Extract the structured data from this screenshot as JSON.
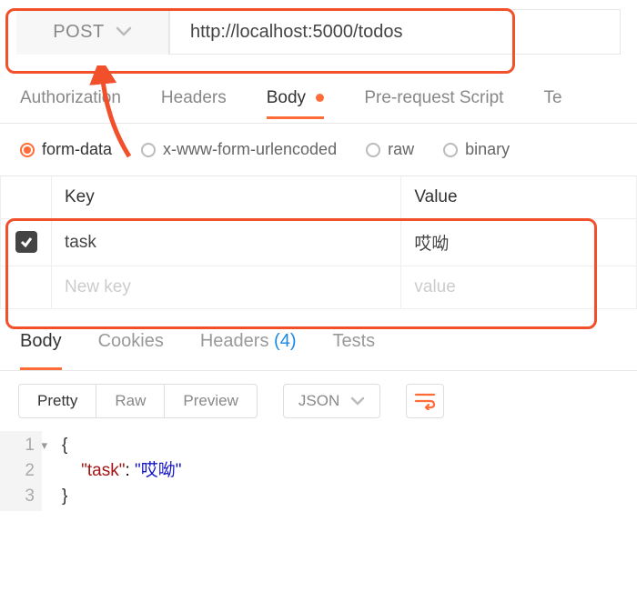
{
  "request": {
    "method": "POST",
    "url": "http://localhost:5000/todos"
  },
  "request_tabs": {
    "authorization": "Authorization",
    "headers": "Headers",
    "body": "Body",
    "prerequest": "Pre-request Script",
    "tests_trunc": "Te"
  },
  "body_types": {
    "form_data": "form-data",
    "urlencoded": "x-www-form-urlencoded",
    "raw": "raw",
    "binary": "binary"
  },
  "form_data": {
    "headers": {
      "key": "Key",
      "value": "Value"
    },
    "rows": [
      {
        "key": "task",
        "value": "哎呦"
      }
    ],
    "placeholder": {
      "key": "New key",
      "value": "value"
    }
  },
  "response_tabs": {
    "body": "Body",
    "cookies": "Cookies",
    "headers": "Headers",
    "headers_count": "(4)",
    "tests": "Tests"
  },
  "resp_toolbar": {
    "pretty": "Pretty",
    "raw": "Raw",
    "preview": "Preview",
    "format": "JSON"
  },
  "response_body": {
    "lines": [
      "1",
      "2",
      "3"
    ],
    "brace_open": "{",
    "brace_close": "}",
    "key": "\"task\"",
    "colon": ": ",
    "value": "\"哎呦\""
  }
}
